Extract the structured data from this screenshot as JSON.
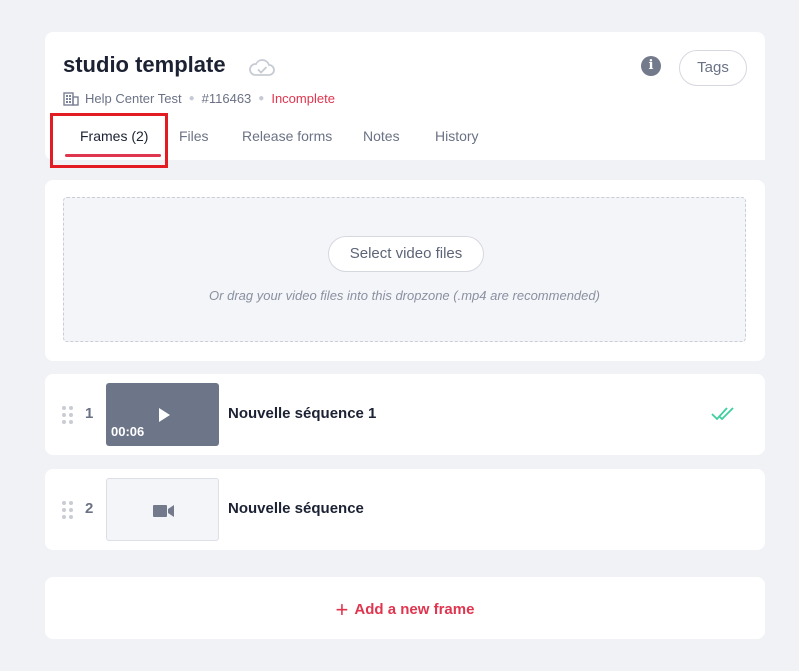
{
  "header": {
    "title": "studio template",
    "sync_icon": "cloud-check-icon",
    "workspace": "Help Center Test",
    "project_id": "#116463",
    "status": "Incomplete",
    "info_icon": "info-icon",
    "tags_label": "Tags",
    "tabs": [
      {
        "label": "Frames (2)",
        "active": true
      },
      {
        "label": "Files"
      },
      {
        "label": "Release forms"
      },
      {
        "label": "Notes"
      },
      {
        "label": "History"
      }
    ]
  },
  "dropzone": {
    "button_label": "Select video files",
    "hint": "Or drag your video files into this dropzone (.mp4 are recommended)"
  },
  "frames": [
    {
      "number": "1",
      "title": "Nouvelle séquence 1",
      "duration": "00:06",
      "thumbnail": "video",
      "status_icon": "double-check-icon"
    },
    {
      "number": "2",
      "title": "Nouvelle séquence",
      "thumbnail": "video-camera-icon"
    }
  ],
  "add_frame": {
    "label": "Add a new frame",
    "icon": "plus-icon"
  },
  "colors": {
    "accent": "#e0354f",
    "check": "#3ecfa0",
    "highlight": "#e31b23"
  }
}
